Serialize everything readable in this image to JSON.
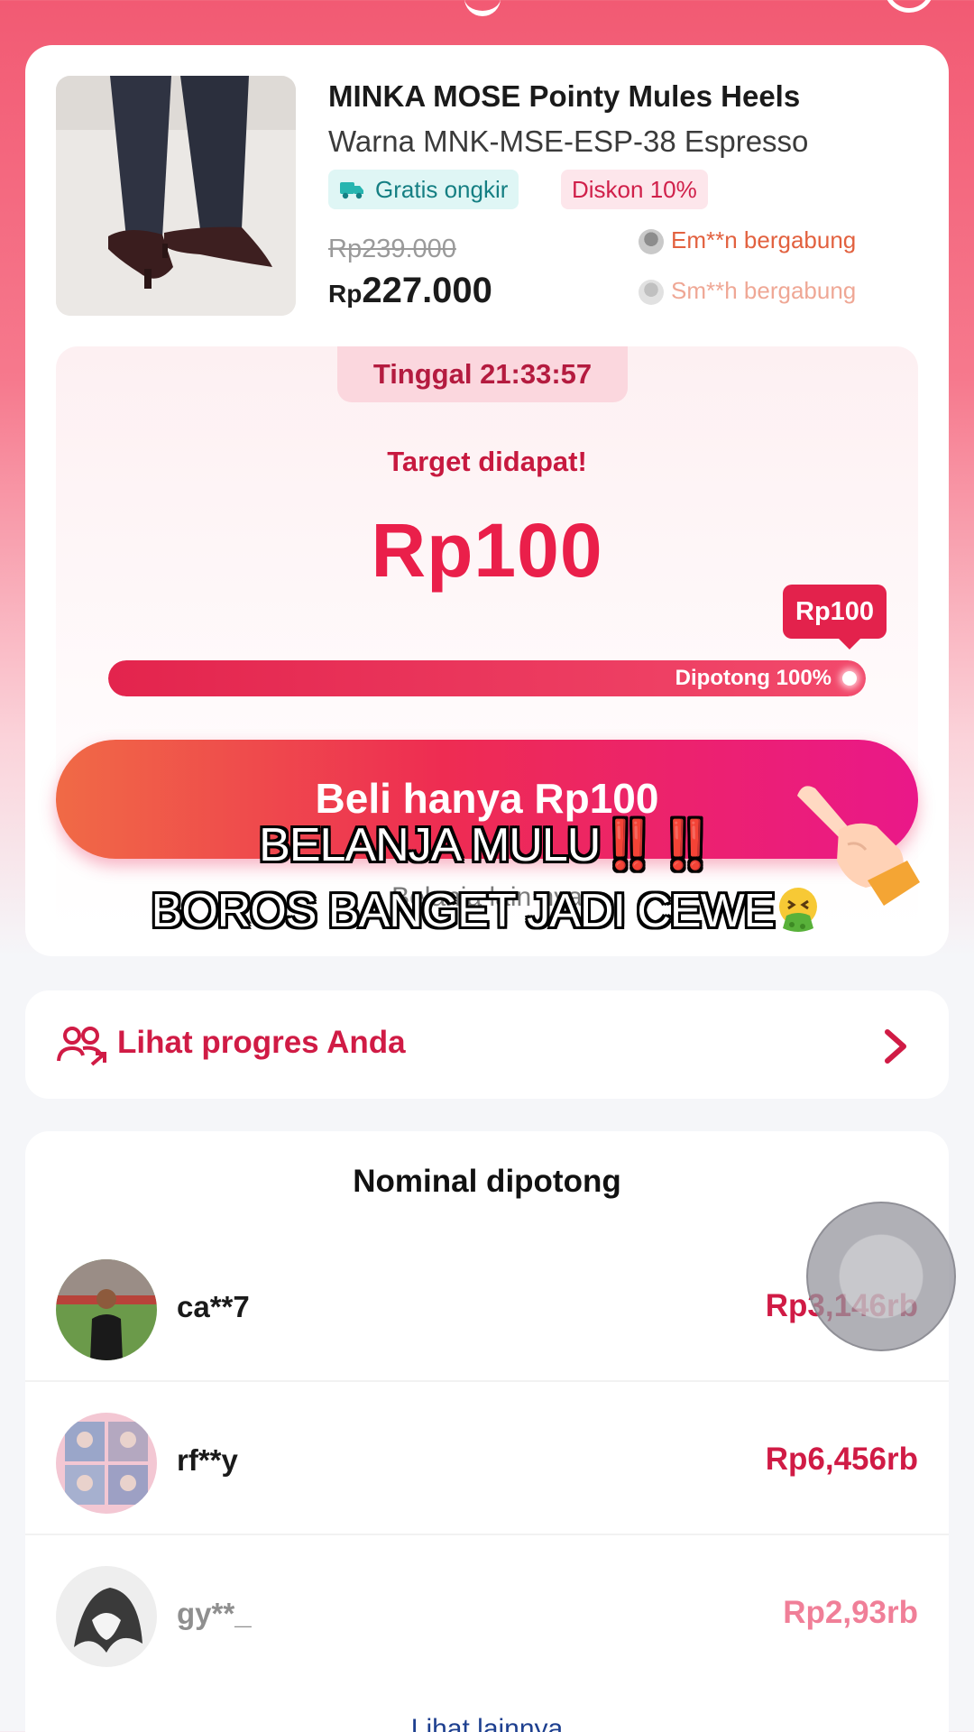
{
  "product": {
    "title": "MINKA MOSE Pointy Mules Heels",
    "variant": "Warna MNK-MSE-ESP-38 Espresso",
    "badge_shipping": "Gratis ongkir",
    "badge_discount": "Diskon 10%",
    "price_original": "Rp239.000",
    "price_currency": "Rp",
    "price_current": "227.000",
    "joined": [
      "Em**n bergabung",
      "Sm**h bergabung"
    ]
  },
  "deal": {
    "timer": "Tinggal 21:33:57",
    "target_label": "Target didapat!",
    "target_amount": "Rp100",
    "bubble_amount": "Rp100",
    "progress_text": "Dipotong 100%",
    "progress_fraction": 1.0,
    "buy_button": "Beli hanya Rp100",
    "sub_line": "Belanja lain nya"
  },
  "overlay": {
    "line1": "BELANJA MULU",
    "line1_marks": "‼️‼️",
    "line2": "BOROS BANGET JADI CEWE"
  },
  "progress_link": {
    "label": "Lihat progres Anda"
  },
  "leaderboard": {
    "title": "Nominal dipotong",
    "rows": [
      {
        "user": "ca**7",
        "amount": "Rp3,146rb"
      },
      {
        "user": "rf**y",
        "amount": "Rp6,456rb"
      },
      {
        "user": "gy**_",
        "amount": "Rp2,93rb"
      }
    ],
    "more": "Lihat lainnya"
  },
  "colors": {
    "accent": "#e3224c",
    "accent_text": "#d01b45",
    "header_pink": "#f25a73"
  }
}
